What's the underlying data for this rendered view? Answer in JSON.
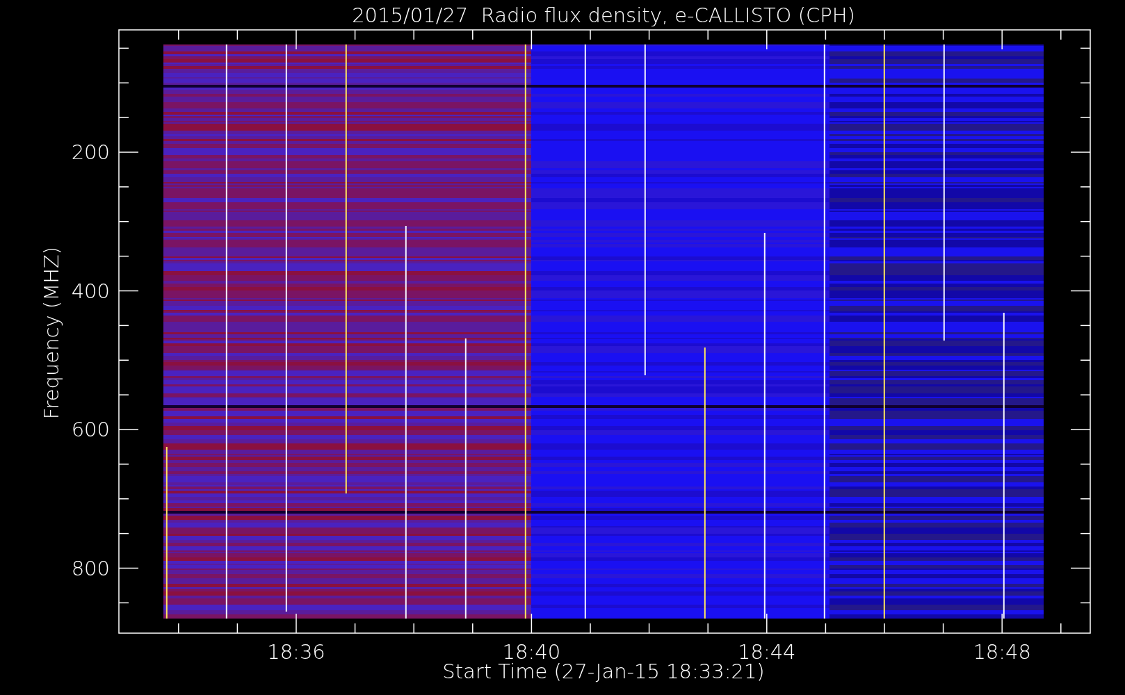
{
  "plot": {
    "title": "2015/01/27  Radio flux density, e-CALLISTO (CPH)",
    "y_axis": {
      "label": "Frequency (MHZ)",
      "ticks": [
        "200",
        "400",
        "600",
        "800"
      ]
    },
    "x_axis": {
      "label": "Start Time (27-Jan-15 18:33:21)",
      "ticks": [
        "18:36",
        "18:40",
        "18:44",
        "18:48"
      ]
    }
  }
}
